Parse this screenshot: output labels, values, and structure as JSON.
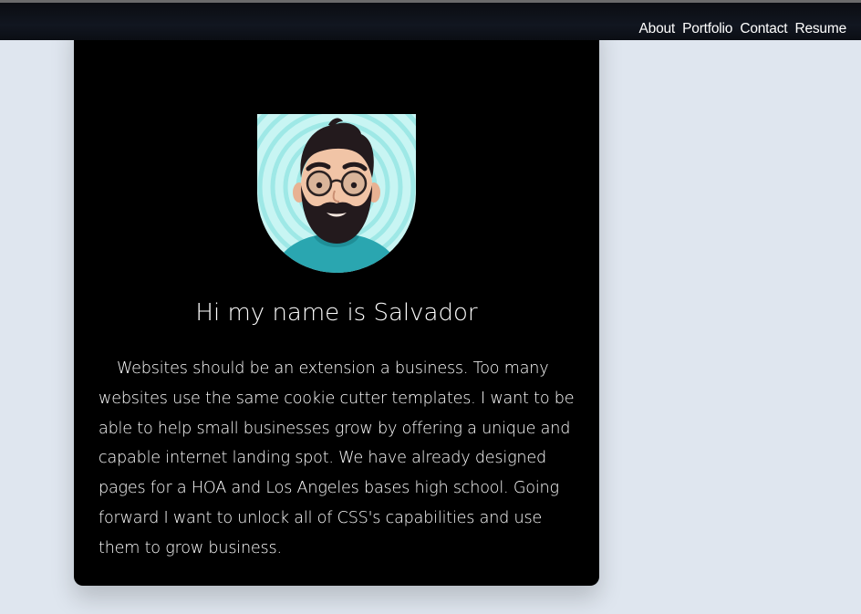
{
  "nav": {
    "items": [
      "About",
      "Portfolio",
      "Contact",
      "Resume"
    ]
  },
  "profile": {
    "avatar_icon": "bearded-man-avatar-icon",
    "heading": "Hi my name is Salvador",
    "bio": "Websites should be an extension a business. Too many websites use the same cookie cutter templates. I want to be able to help small businesses grow by offering a unique and capable internet landing spot. We have already designed pages for a HOA and Los Angeles bases high school. Going forward I want to unlock all of CSS's capabilities and use them to grow business."
  },
  "colors": {
    "page_background": "#dfe6ef",
    "card_background": "#000000",
    "text": "#ffffff",
    "avatar_background": "#bff2f0",
    "avatar_hoodie": "#2aa6b0"
  }
}
